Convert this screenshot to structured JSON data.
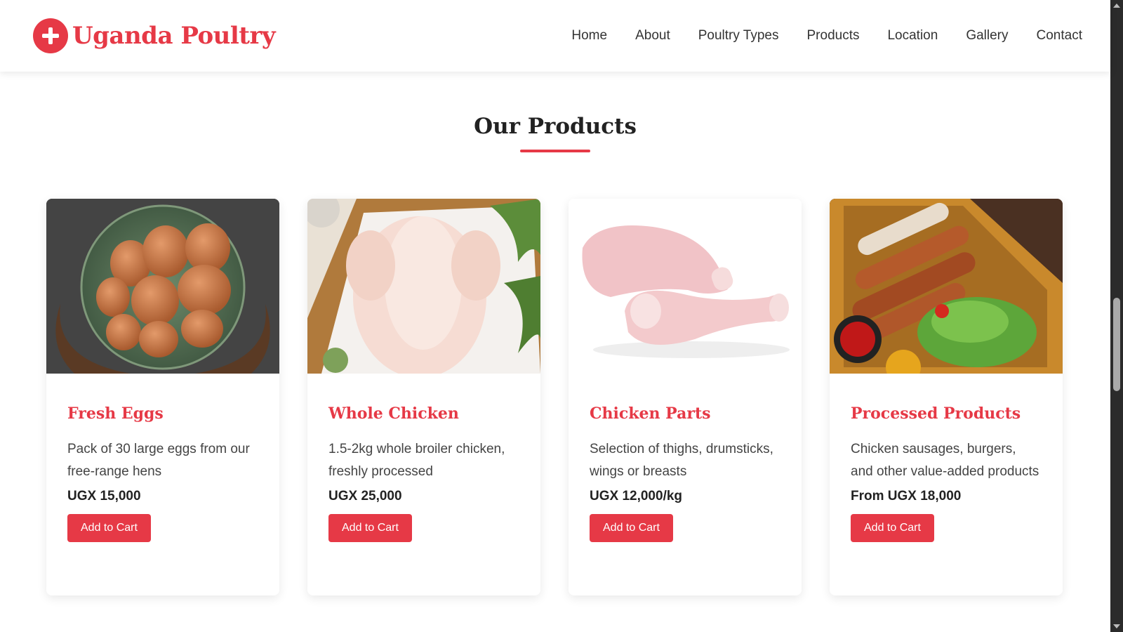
{
  "brand": {
    "name": "Uganda Poultry",
    "logo_icon": "plus-circle-icon",
    "color": "#e63946"
  },
  "nav": {
    "items": [
      {
        "label": "Home"
      },
      {
        "label": "About"
      },
      {
        "label": "Poultry Types"
      },
      {
        "label": "Products"
      },
      {
        "label": "Location"
      },
      {
        "label": "Gallery"
      },
      {
        "label": "Contact"
      }
    ]
  },
  "section": {
    "title": "Our Products"
  },
  "products": [
    {
      "title": "Fresh Eggs",
      "description": "Pack of 30 large eggs from our free-range hens",
      "price": "UGX 15,000",
      "button": "Add to Cart",
      "image": "eggs-in-bowl-photo"
    },
    {
      "title": "Whole Chicken",
      "description": "1.5-2kg whole broiler chicken, freshly processed",
      "price": "UGX 25,000",
      "button": "Add to Cart",
      "image": "raw-whole-chicken-photo"
    },
    {
      "title": "Chicken Parts",
      "description": "Selection of thighs, drumsticks, wings or breasts",
      "price": "UGX 12,000/kg",
      "button": "Add to Cart",
      "image": "raw-drumsticks-photo"
    },
    {
      "title": "Processed Products",
      "description": "Chicken sausages, burgers, and other value-added products",
      "price": "From UGX 18,000",
      "button": "Add to Cart",
      "image": "sausages-on-board-photo"
    }
  ]
}
